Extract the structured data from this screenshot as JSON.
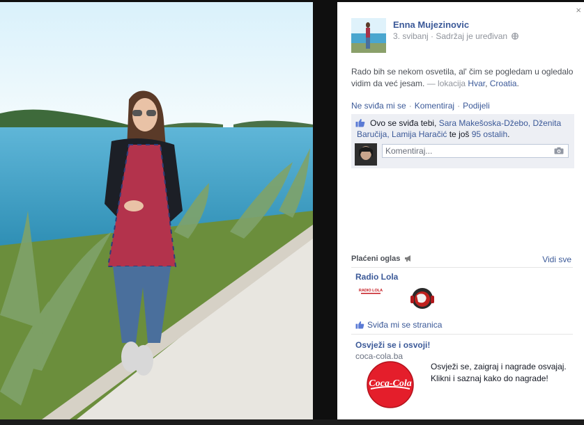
{
  "post": {
    "author": "Enna Mujezinovic",
    "date": "3. svibanj",
    "meta_sep": " · ",
    "edited": "Sadržaj je uređivan",
    "text": "Rado bih se nekom osvetila, al' čim se pogledam u ogledalo vidim da već jesam.",
    "location_prefix": " — lokacija ",
    "location_city": "Hvar",
    "location_sep": ", ",
    "location_country": "Croatia",
    "location_end": "."
  },
  "actions": {
    "unlike": "Ne sviđa mi se",
    "comment": "Komentiraj",
    "share": "Podijeli",
    "sep": "·"
  },
  "likes": {
    "prefix": "Ovo se sviđa tebi, ",
    "names": "Sara Makešoska-Džebo, Dženita Baručija, Lamija Haračić",
    "middle": " te još ",
    "others": "95 ostalih",
    "end": "."
  },
  "comment_box": {
    "placeholder": "Komentiraj..."
  },
  "ads": {
    "header": "Plaćeni oglas",
    "see_all": "Vidi sve",
    "ad1": {
      "title": "Radio Lola",
      "logo_text": "RADIO LOLA",
      "like_page": "Sviđa mi se stranica"
    },
    "ad2": {
      "title": "Osvježi se i osvoji!",
      "domain": "coca-cola.ba",
      "logo_text": "Coca-Cola",
      "description": "Osvježi se, zaigraj i nagrade osvajaj. Klikni i saznaj kako do nagrade!"
    }
  },
  "ui": {
    "close": "×"
  },
  "colors": {
    "link": "#3b5998",
    "panel_bg": "#ffffff",
    "likes_bg": "#edeff4",
    "coca_cola_red": "#e41e2b"
  }
}
